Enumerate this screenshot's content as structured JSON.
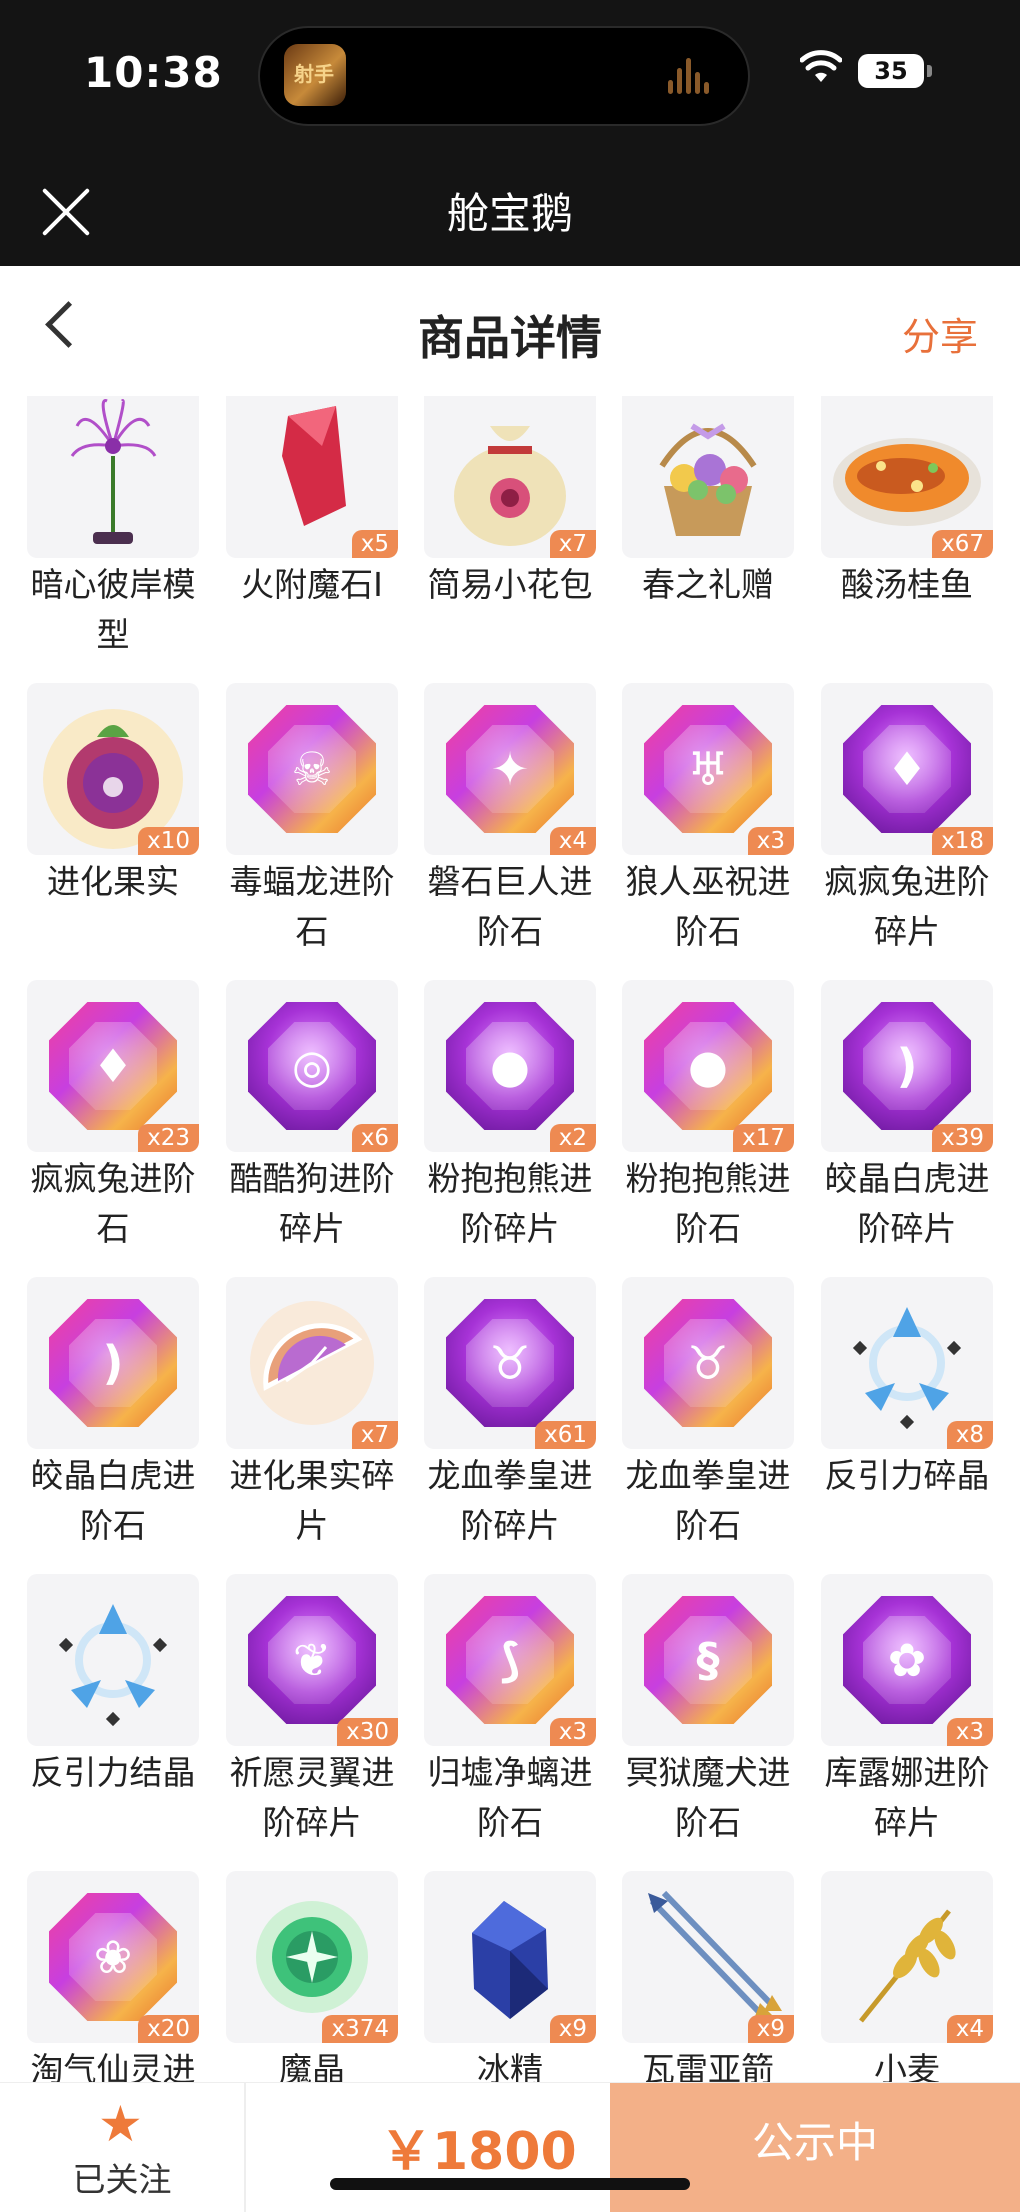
{
  "status_bar": {
    "time": "10:38",
    "battery": "35"
  },
  "app_bar": {
    "title": "舱宝鹅"
  },
  "page_header": {
    "title": "商品详情",
    "share_label": "分享"
  },
  "items": [
    {
      "name": "暗心彼岸模型",
      "qty": "",
      "icon": "red-spider-lily-icon"
    },
    {
      "name": "火附魔石I",
      "qty": "x5",
      "icon": "red-crystal-icon"
    },
    {
      "name": "简易小花包",
      "qty": "x7",
      "icon": "flower-pouch-icon"
    },
    {
      "name": "春之礼赠",
      "qty": "",
      "icon": "flower-basket-icon"
    },
    {
      "name": "酸汤桂鱼",
      "qty": "x67",
      "icon": "fish-dish-icon"
    },
    {
      "name": "进化果实",
      "qty": "x10",
      "icon": "evolution-fruit-icon"
    },
    {
      "name": "毒蝠龙进阶石",
      "qty": "",
      "icon": "bat-dragon-gem-icon",
      "gem": "gold",
      "sym": "☠"
    },
    {
      "name": "磐石巨人进阶石",
      "qty": "x4",
      "icon": "rock-giant-gem-icon",
      "gem": "gold",
      "sym": "✦"
    },
    {
      "name": "狼人巫祝进阶石",
      "qty": "x3",
      "icon": "werewolf-gem-icon",
      "gem": "gold",
      "sym": "♅"
    },
    {
      "name": "疯疯兔进阶碎片",
      "qty": "x18",
      "icon": "carrot-gem-icon",
      "gem": "purple",
      "sym": "♦"
    },
    {
      "name": "疯疯兔进阶石",
      "qty": "x23",
      "icon": "carrot-gem-icon",
      "gem": "gold",
      "sym": "♦"
    },
    {
      "name": "酷酷狗进阶碎片",
      "qty": "x6",
      "icon": "goggles-gem-icon",
      "gem": "purple",
      "sym": "◎"
    },
    {
      "name": "粉抱抱熊进阶碎片",
      "qty": "x2",
      "icon": "cocoon-gem-icon",
      "gem": "purple",
      "sym": "●"
    },
    {
      "name": "粉抱抱熊进阶石",
      "qty": "x17",
      "icon": "cocoon-gem-icon",
      "gem": "gold",
      "sym": "●"
    },
    {
      "name": "皎晶白虎进阶碎片",
      "qty": "x39",
      "icon": "fang-gem-icon",
      "gem": "purple",
      "sym": ")"
    },
    {
      "name": "皎晶白虎进阶石",
      "qty": "",
      "icon": "fang-gem-icon",
      "gem": "gold",
      "sym": ")"
    },
    {
      "name": "进化果实碎片",
      "qty": "x7",
      "icon": "fruit-slice-icon"
    },
    {
      "name": "龙血拳皇进阶碎片",
      "qty": "x61",
      "icon": "bull-gem-icon",
      "gem": "purple",
      "sym": "♉"
    },
    {
      "name": "龙血拳皇进阶石",
      "qty": "",
      "icon": "bull-gem-icon",
      "gem": "gold",
      "sym": "♉"
    },
    {
      "name": "反引力碎晶",
      "qty": "x8",
      "icon": "antigravity-crystal-icon"
    },
    {
      "name": "反引力结晶",
      "qty": "",
      "icon": "antigravity-crystal-icon"
    },
    {
      "name": "祈愿灵翼进阶碎片",
      "qty": "x30",
      "icon": "wing-gem-icon",
      "gem": "purple",
      "sym": "❦"
    },
    {
      "name": "归墟净螭进阶石",
      "qty": "x3",
      "icon": "dragon-scale-gem-icon",
      "gem": "gold",
      "sym": "⟆"
    },
    {
      "name": "冥狱魔犬进阶石",
      "qty": "",
      "icon": "hound-gem-icon",
      "gem": "gold",
      "sym": "§"
    },
    {
      "name": "库露娜进阶碎片",
      "qty": "x3",
      "icon": "octopus-gem-icon",
      "gem": "purple",
      "sym": "✿"
    },
    {
      "name": "淘气仙灵进",
      "qty": "x20",
      "icon": "fairy-gem-icon",
      "gem": "gold",
      "sym": "❀"
    },
    {
      "name": "魔晶",
      "qty": "x374",
      "icon": "magic-crystal-icon"
    },
    {
      "name": "冰精",
      "qty": "x9",
      "icon": "ice-essence-icon"
    },
    {
      "name": "瓦雷亚箭",
      "qty": "x9",
      "icon": "arrows-icon"
    },
    {
      "name": "小麦",
      "qty": "x4",
      "icon": "wheat-icon"
    }
  ],
  "bottom_bar": {
    "follow_label": "已关注",
    "price": "￥1800",
    "status_label": "公示中"
  },
  "colors": {
    "accent": "#ee7a3a",
    "status_button": "#f3b088",
    "dark_header": "#141414"
  }
}
